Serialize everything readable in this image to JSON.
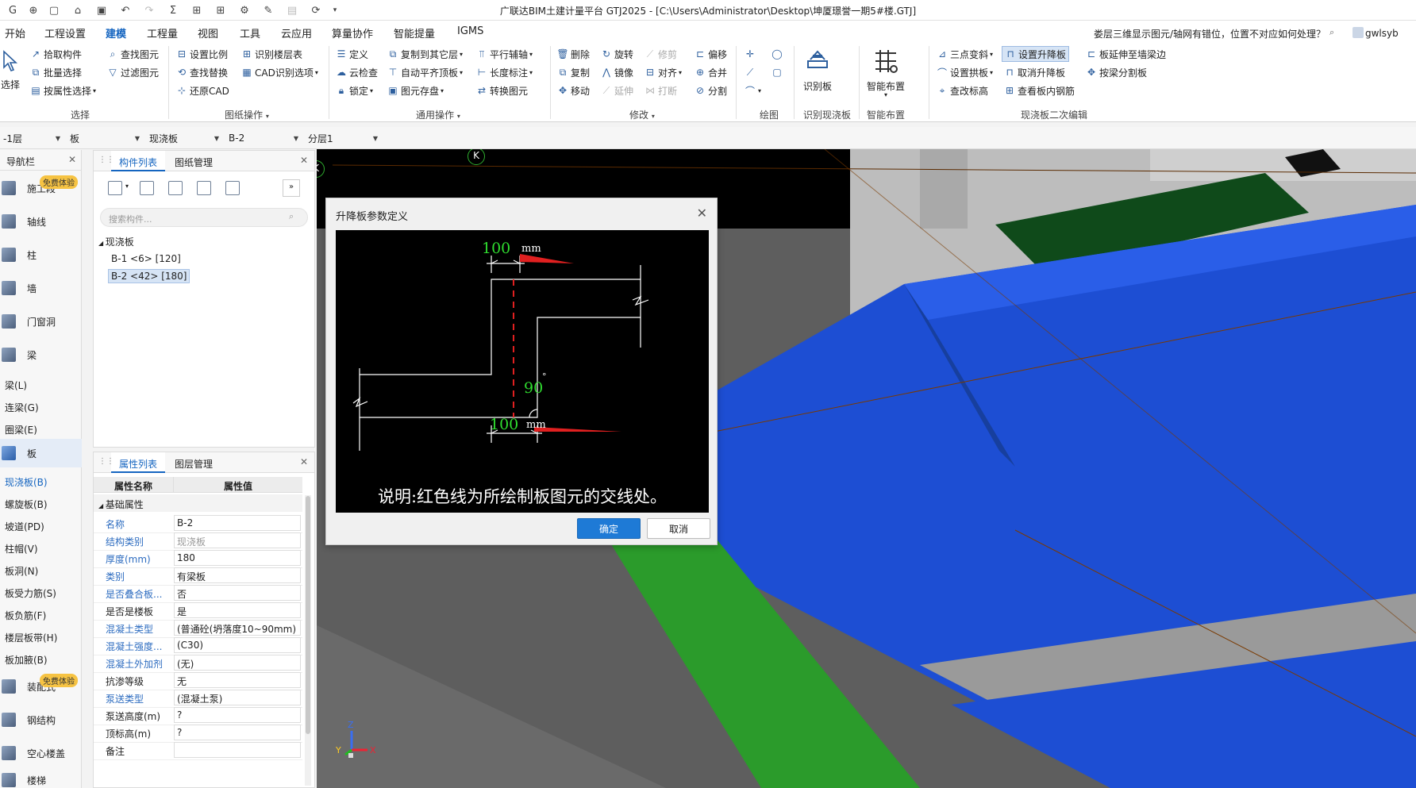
{
  "window": {
    "title": "广联达BIM土建计量平台 GTJ2025 - [C:\\Users\\Administrator\\Desktop\\坤厦璟誉一期5#楼.GTJ]"
  },
  "menu": {
    "items": [
      "开始",
      "工程设置",
      "建模",
      "工程量",
      "视图",
      "工具",
      "云应用",
      "算量协作",
      "智能提量",
      "IGMS"
    ],
    "active": "建模",
    "help_question": "娄层三维显示图元/轴网有错位，位置不对应如何处理？",
    "user": "gwlsyb"
  },
  "ribbon": {
    "select_big": "选择",
    "select": {
      "pick": "拾取构件",
      "batch": "批量选择",
      "by_attr": "按属性选择",
      "find": "查找图元",
      "filter": "过滤图元",
      "label": "选择"
    },
    "drawing_ops": {
      "scale": "设置比例",
      "find_replace": "查找替换",
      "restore_cad": "还原CAD",
      "floor_table": "识别楼层表",
      "cad_options": "CAD识别选项",
      "label": "图纸操作"
    },
    "common": {
      "define": "定义",
      "cloud_check": "云检查",
      "lock": "锁定",
      "copy_floor": "复制到其它层",
      "auto_align": "自动平齐顶板",
      "save_elem": "图元存盘",
      "parallel_aux": "平行辅轴",
      "length_dim": "长度标注",
      "convert_elem": "转换图元",
      "label": "通用操作"
    },
    "modify": {
      "delete": "删除",
      "copy": "复制",
      "move": "移动",
      "rotate": "旋转",
      "mirror": "镜像",
      "extend": "延伸",
      "trim": "修剪",
      "align": "对齐",
      "break": "打断",
      "offset": "偏移",
      "merge": "合并",
      "split": "分割",
      "label": "修改"
    },
    "draw_label": "绘图",
    "recognize_slab": "识别板",
    "recognize_slab_group": "识别现浇板",
    "smart_layout": "智能布置",
    "smart_layout_group": "智能布置",
    "slab_edit": {
      "three_point_slope": "三点变斜",
      "set_arch": "设置拱板",
      "change_elev": "查改标高",
      "set_raise": "设置升降板",
      "cancel_raise": "取消升降板",
      "view_rebar": "查看板内钢筋",
      "extend_beam": "板延伸至墙梁边",
      "split_by_beam": "按梁分割板",
      "label": "现浇板二次编辑"
    }
  },
  "combos": [
    "-1层",
    "板",
    "现浇板",
    "B-2",
    "分层1"
  ],
  "nav": {
    "title": "导航栏",
    "badge": "免费体验",
    "big_items": [
      "施工段",
      "轴线",
      "柱",
      "墙",
      "门窗洞",
      "梁",
      "板",
      "装配式",
      "钢结构",
      "空心楼盖",
      "楼梯"
    ],
    "small_items": [
      "梁(L)",
      "连梁(G)",
      "圈梁(E)",
      "现浇板(B)",
      "螺旋板(B)",
      "坡道(PD)",
      "柱帽(V)",
      "板洞(N)",
      "板受力筋(S)",
      "板负筋(F)",
      "楼层板带(H)",
      "板加腋(B)"
    ]
  },
  "component_panel": {
    "tab1": "构件列表",
    "tab2": "图纸管理",
    "search_placeholder": "搜索构件...",
    "root": "现浇板",
    "items": [
      "B-1 <6> [120]",
      "B-2 <42> [180]"
    ]
  },
  "property_panel": {
    "tab1": "属性列表",
    "tab2": "图层管理",
    "col_name": "属性名称",
    "col_value": "属性值",
    "group": "基础属性",
    "rows": [
      {
        "name": "名称",
        "value": "B-2"
      },
      {
        "name": "结构类别",
        "value": "现浇板"
      },
      {
        "name": "厚度(mm)",
        "value": "180"
      },
      {
        "name": "类别",
        "value": "有梁板"
      },
      {
        "name": "是否叠合板...",
        "value": "否"
      },
      {
        "name": "是否是楼板",
        "value": "是"
      },
      {
        "name": "混凝土类型",
        "value": "(普通砼(坍落度10~90mm) ..."
      },
      {
        "name": "混凝土强度...",
        "value": "(C30)"
      },
      {
        "name": "混凝土外加剂",
        "value": "(无)"
      },
      {
        "name": "抗渗等级",
        "value": "无"
      },
      {
        "name": "泵送类型",
        "value": "(混凝土泵)"
      },
      {
        "name": "泵送高度(m)",
        "value": "?"
      },
      {
        "name": "顶标高(m)",
        "value": "?"
      },
      {
        "name": "备注",
        "value": ""
      }
    ]
  },
  "viewport": {
    "axis_label_top": "K",
    "axis_label_left": "K",
    "axis_x": "X",
    "axis_y": "Y",
    "axis_z": "Z"
  },
  "dialog": {
    "title": "升降板参数定义",
    "dim_top": "100",
    "dim_top_unit": "mm",
    "dim_bottom": "100",
    "dim_bottom_unit": "mm",
    "angle": "90",
    "angle_unit": "°",
    "note": "说明:红色线为所绘制板图元的交线处。",
    "ok": "确定",
    "cancel": "取消"
  },
  "colors": {
    "accent": "#1565c0",
    "slab_blue": "#1e4fc9",
    "green_strip": "#2b9a2b"
  }
}
